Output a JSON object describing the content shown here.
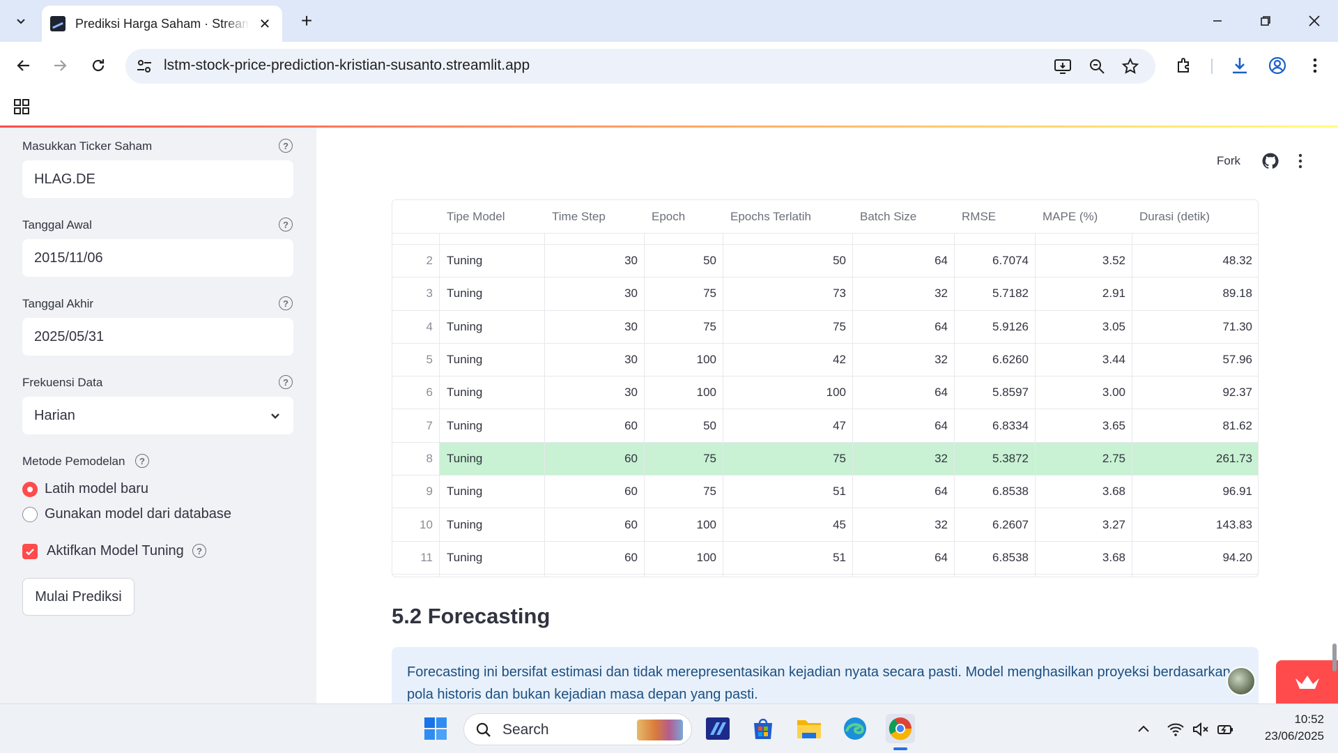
{
  "browser": {
    "tab_title": "Prediksi Harga Saham · Streamlit",
    "url": "lstm-stock-price-prediction-kristian-susanto.streamlit.app"
  },
  "sidebar": {
    "ticker": {
      "label": "Masukkan Ticker Saham",
      "value": "HLAG.DE"
    },
    "start_date": {
      "label": "Tanggal Awal",
      "value": "2015/11/06"
    },
    "end_date": {
      "label": "Tanggal Akhir",
      "value": "2025/05/31"
    },
    "frequency": {
      "label": "Frekuensi Data",
      "value": "Harian"
    },
    "method": {
      "label": "Metode Pemodelan",
      "options": [
        "Latih model baru",
        "Gunakan model dari database"
      ],
      "selected": "Latih model baru"
    },
    "tuning": {
      "label": "Aktifkan Model Tuning",
      "checked": true
    },
    "predict_button": "Mulai Prediksi"
  },
  "header": {
    "fork": "Fork"
  },
  "table": {
    "columns": [
      "",
      "Tipe Model",
      "Time Step",
      "Epoch",
      "Epochs Terlatih",
      "Batch Size",
      "RMSE",
      "MAPE (%)",
      "Durasi (detik)"
    ],
    "rows": [
      [
        "2",
        "Tuning",
        "30",
        "50",
        "50",
        "64",
        "6.7074",
        "3.52",
        "48.32"
      ],
      [
        "3",
        "Tuning",
        "30",
        "75",
        "73",
        "32",
        "5.7182",
        "2.91",
        "89.18"
      ],
      [
        "4",
        "Tuning",
        "30",
        "75",
        "75",
        "64",
        "5.9126",
        "3.05",
        "71.30"
      ],
      [
        "5",
        "Tuning",
        "30",
        "100",
        "42",
        "32",
        "6.6260",
        "3.44",
        "57.96"
      ],
      [
        "6",
        "Tuning",
        "30",
        "100",
        "100",
        "64",
        "5.8597",
        "3.00",
        "92.37"
      ],
      [
        "7",
        "Tuning",
        "60",
        "50",
        "47",
        "64",
        "6.8334",
        "3.65",
        "81.62"
      ],
      [
        "8",
        "Tuning",
        "60",
        "75",
        "75",
        "32",
        "5.3872",
        "2.75",
        "261.73"
      ],
      [
        "9",
        "Tuning",
        "60",
        "75",
        "51",
        "64",
        "6.8538",
        "3.68",
        "96.91"
      ],
      [
        "10",
        "Tuning",
        "60",
        "100",
        "45",
        "32",
        "6.2607",
        "3.27",
        "143.83"
      ],
      [
        "11",
        "Tuning",
        "60",
        "100",
        "51",
        "64",
        "6.8538",
        "3.68",
        "94.20"
      ]
    ],
    "highlight_row": "8",
    "highlight_color": "#c8f2d3"
  },
  "forecast": {
    "title": "5.2 Forecasting",
    "info": "Forecasting ini bersifat estimasi dan tidak merepresentasikan kejadian nyata secara pasti. Model menghasilkan proyeksi berdasarkan pola historis dan bukan kejadian masa depan yang pasti."
  },
  "taskbar": {
    "search": "Search",
    "time": "10:52",
    "date": "23/06/2025"
  },
  "colors": {
    "accent": "#ff4b4b",
    "sidebar_bg": "#f0f2f6",
    "info_bg": "#e8f1fb",
    "info_text": "#1c4e80"
  }
}
